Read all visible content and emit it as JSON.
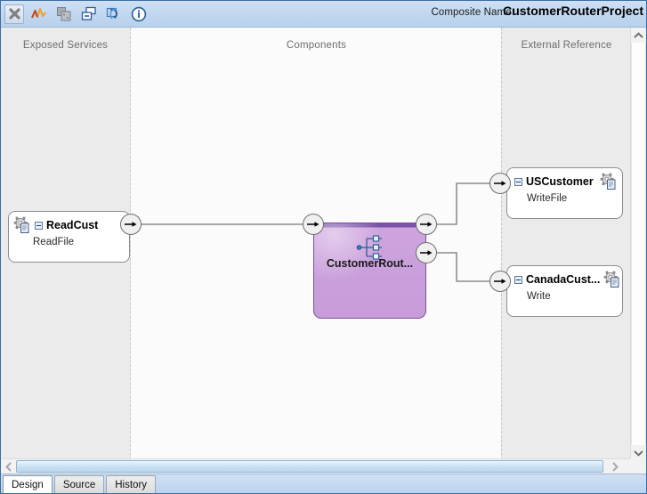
{
  "window": {
    "composite_label": "Composite Name:",
    "composite_name": "CustomerRouterProject"
  },
  "toolbar": {
    "buttons": [
      {
        "name": "close-icon",
        "label": "X",
        "pressed": true
      },
      {
        "name": "chart-icon",
        "label": ""
      },
      {
        "name": "copy-icon",
        "label": ""
      },
      {
        "name": "collapse-icon",
        "label": ""
      },
      {
        "name": "refresh-icon",
        "label": ""
      },
      {
        "name": "info-icon",
        "label": ""
      }
    ]
  },
  "lanes": {
    "exposed_services": "Exposed Services",
    "components": "Components",
    "external_reference": "External Reference"
  },
  "nodes": {
    "service": {
      "title": "ReadCust",
      "subtitle": "ReadFile",
      "icon": "service-gear-icon",
      "port": "output-port"
    },
    "mediator": {
      "title": "CustomerRout...",
      "icon": "mediator-router-icon",
      "color": "#c99fdb",
      "header_color": "#7b52a8",
      "input_port": "input-port",
      "output_ports": [
        "output-port-1",
        "output-port-2"
      ]
    },
    "references": [
      {
        "title": "USCustomer",
        "subtitle": "WriteFile",
        "icon": "reference-gear-icon",
        "port": "input-port"
      },
      {
        "title": "CanadaCust...",
        "subtitle": "Write",
        "icon": "reference-gear-icon",
        "port": "input-port"
      }
    ]
  },
  "scrollbars": {
    "vertical": {
      "up": "▲",
      "down": "▼"
    },
    "horizontal": {
      "left": "◀",
      "right": "▶"
    }
  },
  "tabs": [
    {
      "label": "Design",
      "active": true
    },
    {
      "label": "Source",
      "active": false
    },
    {
      "label": "History",
      "active": false
    }
  ]
}
